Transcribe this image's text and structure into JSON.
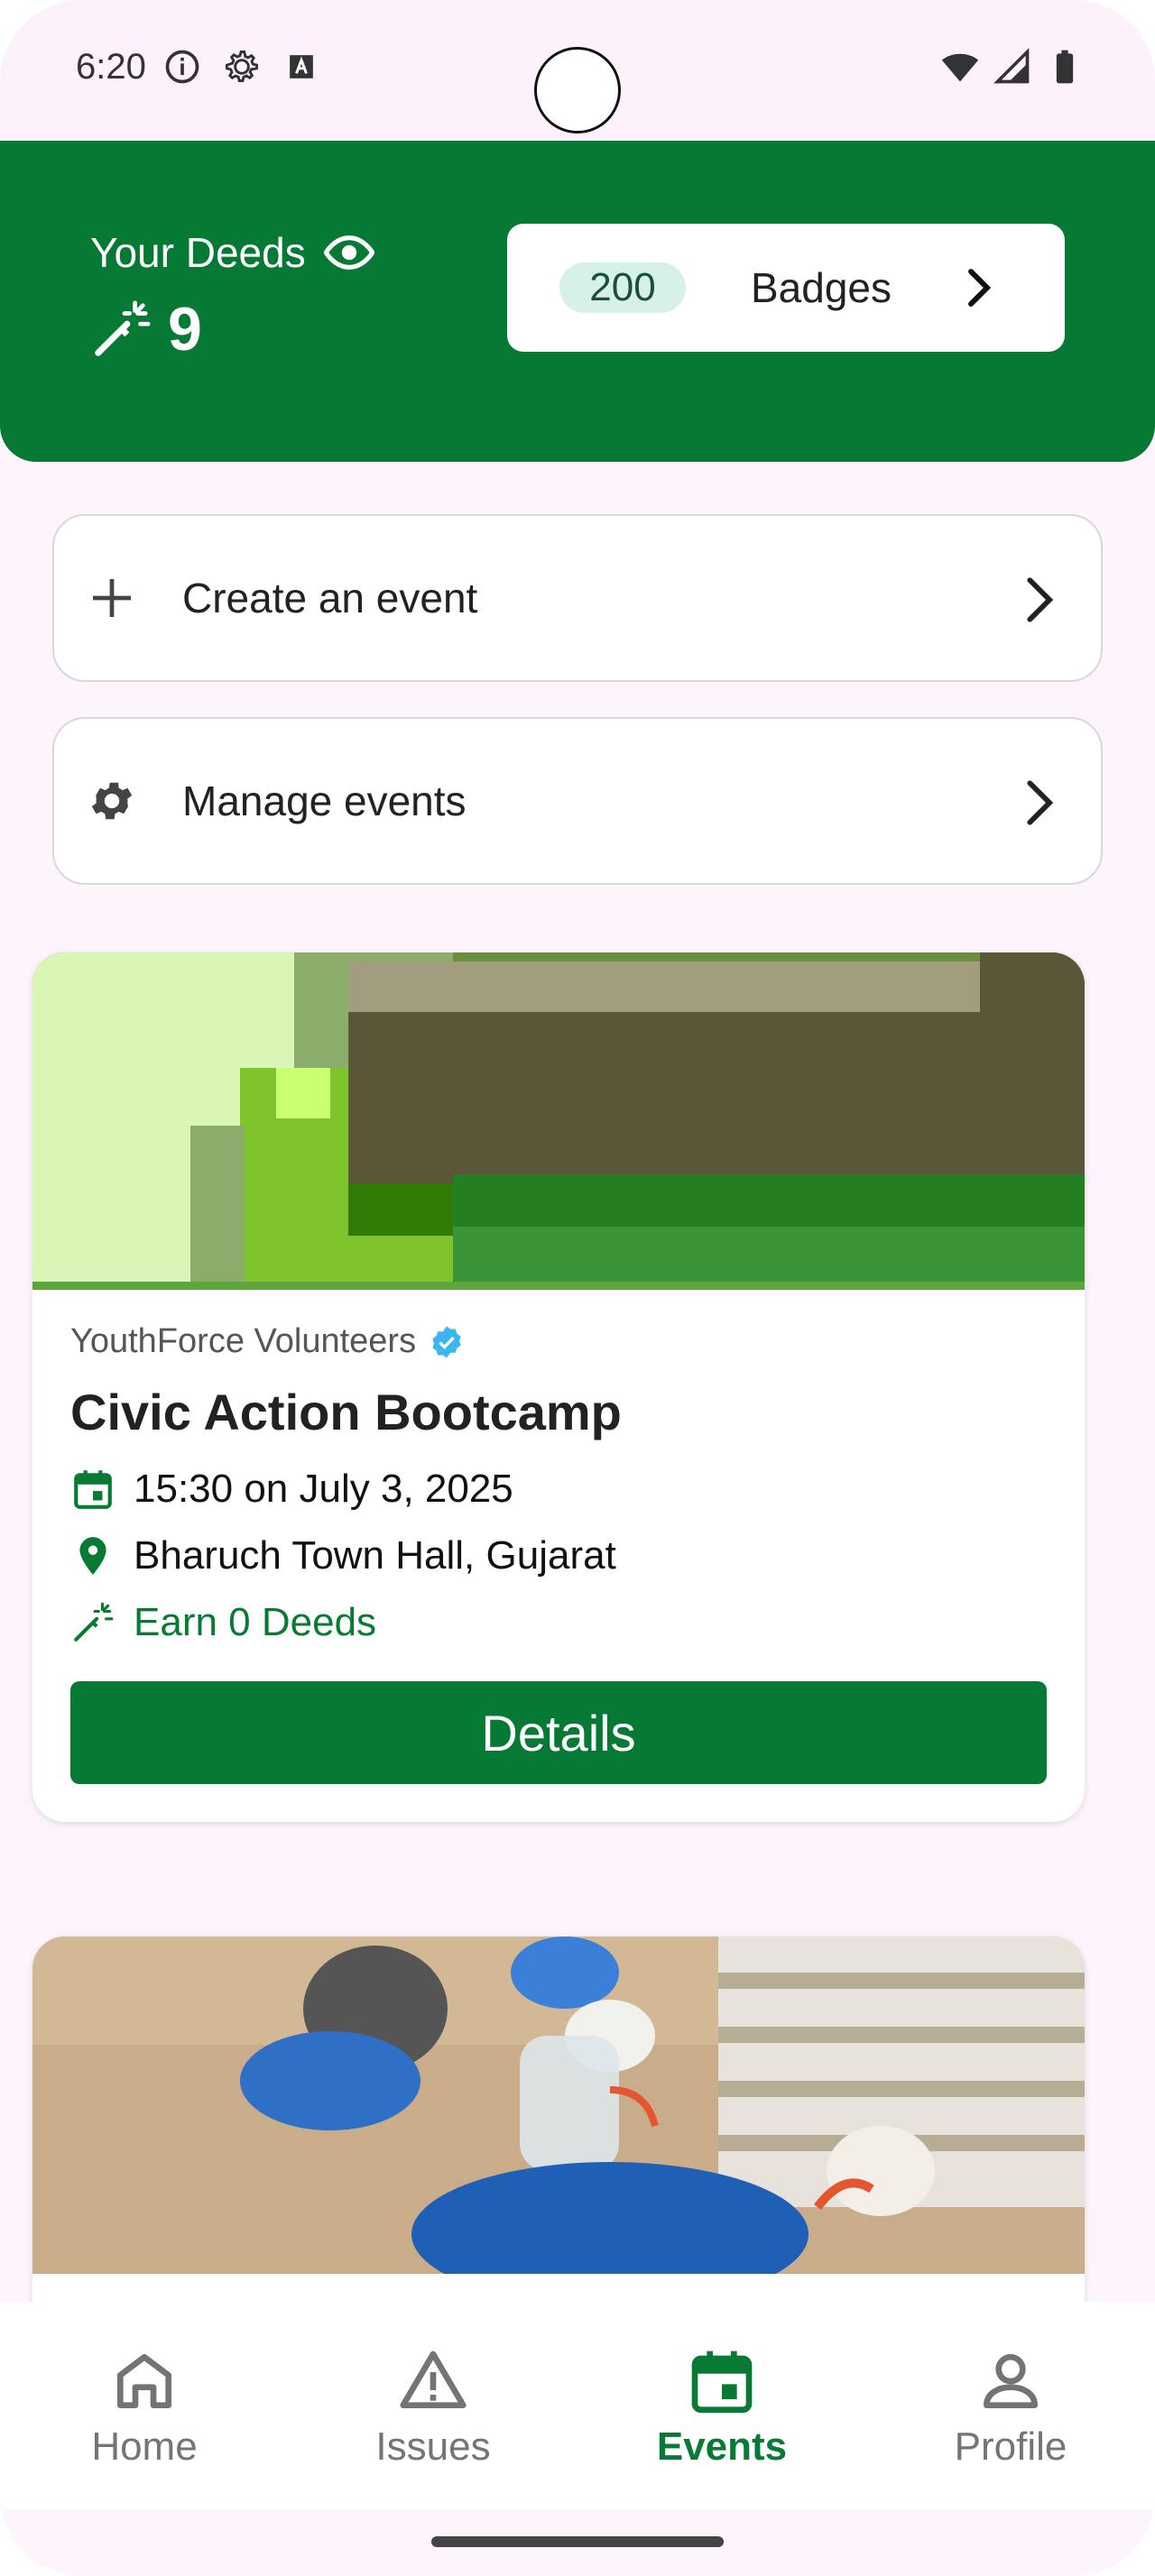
{
  "status_bar": {
    "time": "6:20"
  },
  "header": {
    "deeds_label": "Your Deeds",
    "deeds_count": "9",
    "badges_count": "200",
    "badges_label": "Badges"
  },
  "actions": [
    {
      "label": "Create an event",
      "icon": "plus-icon"
    },
    {
      "label": "Manage events",
      "icon": "gear-icon"
    }
  ],
  "events": [
    {
      "organizer": "YouthForce Volunteers",
      "title": "Civic Action Bootcamp",
      "datetime": "15:30 on July 3, 2025",
      "location": "Bharuch Town Hall, Gujarat",
      "reward": "Earn 0 Deeds",
      "button": "Details"
    }
  ],
  "nav": [
    {
      "label": "Home",
      "icon": "home-icon",
      "active": false
    },
    {
      "label": "Issues",
      "icon": "warning-icon",
      "active": false
    },
    {
      "label": "Events",
      "icon": "calendar-icon",
      "active": true
    },
    {
      "label": "Profile",
      "icon": "person-icon",
      "active": false
    }
  ],
  "colors": {
    "primary": "#067a34",
    "pill_bg": "#d5f1e8",
    "verified": "#3bb6f0"
  }
}
